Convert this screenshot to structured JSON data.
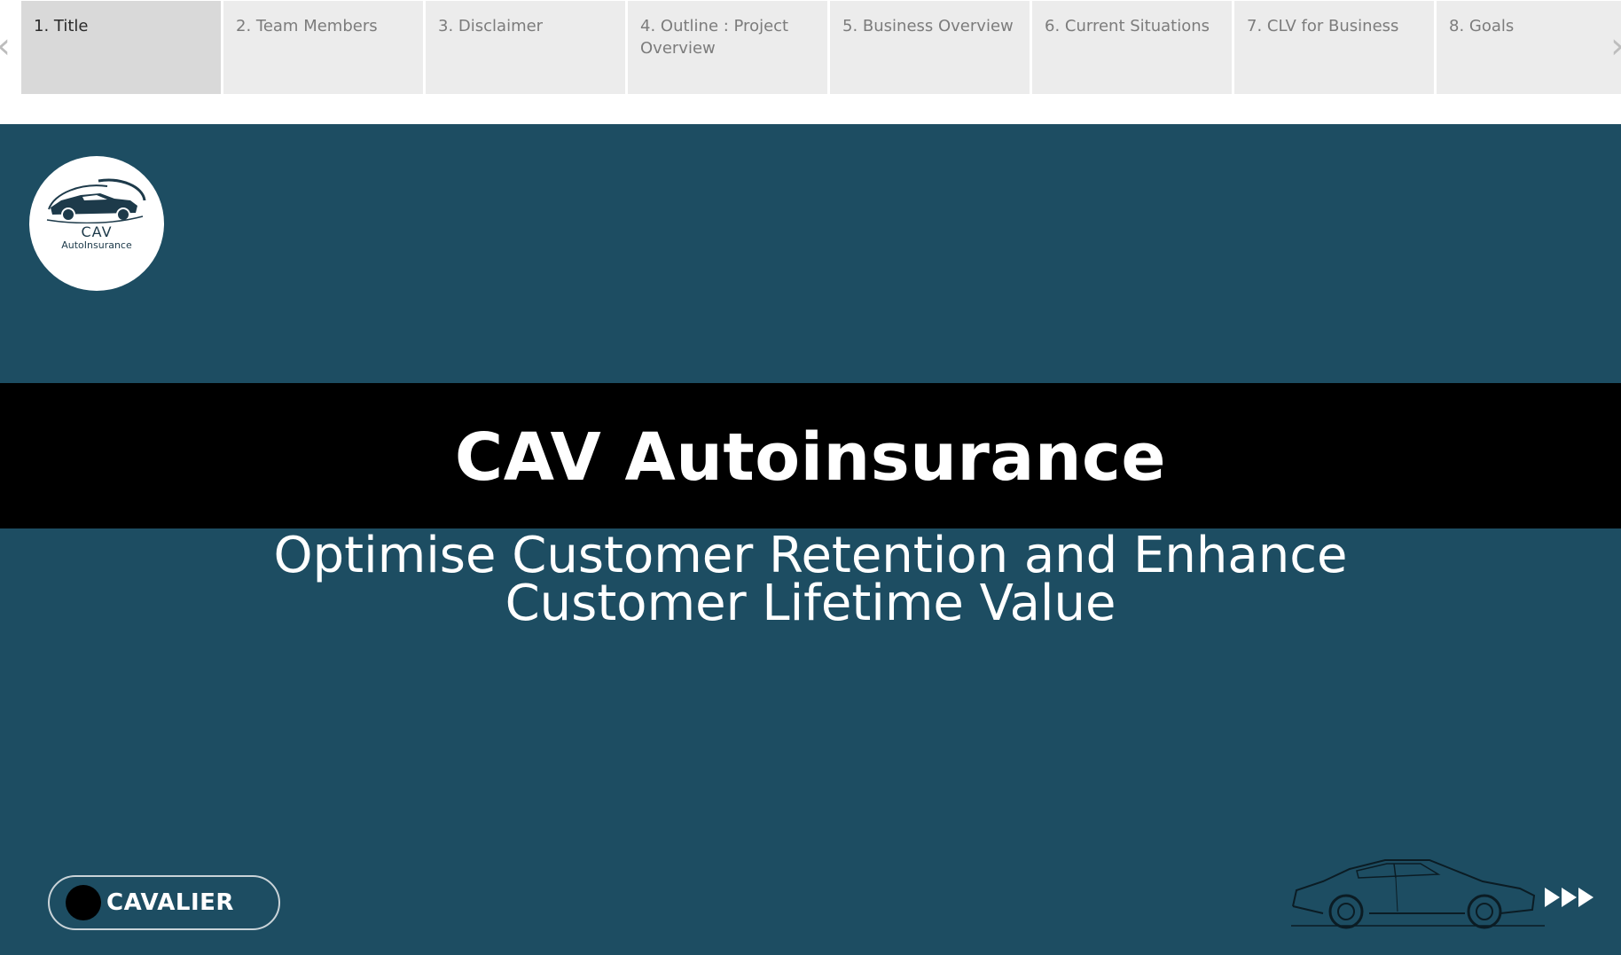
{
  "storypoints": [
    {
      "label": "1. Title",
      "active": true
    },
    {
      "label": "2. Team Members",
      "active": false
    },
    {
      "label": "3. Disclaimer",
      "active": false
    },
    {
      "label": "4. Outline : Project Overview",
      "active": false
    },
    {
      "label": "5. Business Overview",
      "active": false
    },
    {
      "label": "6. Current Situations",
      "active": false
    },
    {
      "label": "7. CLV for Business",
      "active": false
    },
    {
      "label": "8. Goals",
      "active": false
    }
  ],
  "nav": {
    "prev_icon": "‹",
    "next_icon": "›"
  },
  "slide": {
    "logo": {
      "name": "CAV",
      "sub": "AutoInsurance"
    },
    "title": "CAV Autoinsurance",
    "subtitle_line1": "Optimise Customer Retention and Enhance",
    "subtitle_line2": "Customer Lifetime Value",
    "brand_button": "CAVALIER"
  },
  "colors": {
    "slide_bg": "#1d4d62",
    "title_band": "#000000",
    "tab_bg": "#ececec",
    "tab_active_bg": "#d9d9d9"
  },
  "icons": [
    "car-logo-icon",
    "car-sketch-icon",
    "next-arrows-icon",
    "chevron-left-icon",
    "chevron-right-icon"
  ]
}
